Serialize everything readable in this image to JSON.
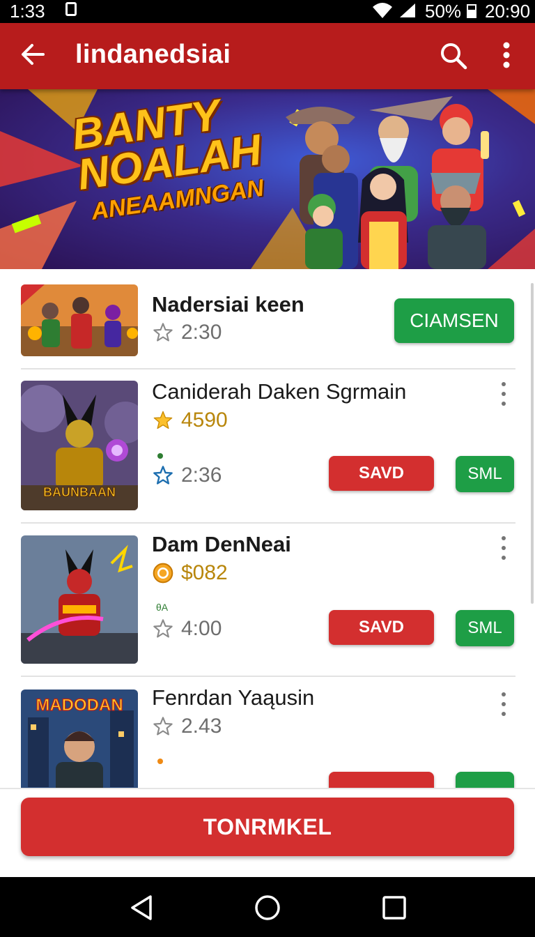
{
  "status_bar": {
    "time": "1:33",
    "battery": "50%",
    "clock": "20:90",
    "icons": [
      "notification-icon",
      "wifi-icon",
      "signal-icon",
      "battery-icon"
    ]
  },
  "app_bar": {
    "title": "lindanedsiai",
    "icons": [
      "back-arrow-icon",
      "search-icon",
      "more-vert-icon"
    ]
  },
  "banner": {
    "line1": "BANTY",
    "line2": "NOALAH",
    "line3": "ANEAAMNGAN"
  },
  "items": [
    {
      "name": "Nadersiai keen",
      "meta": "2:30",
      "meta_icon": "star-outline-icon",
      "primary_button": "CIAMSEN"
    },
    {
      "name": "Caniderah Daken Sgrmain",
      "price": "4590",
      "price_icon": "star-filled-icon",
      "meta": "2:36",
      "meta_icon": "star-outline-blue-icon",
      "thumb_caption": "BAUNBAAN",
      "save_button": "SAVD",
      "small_button": "SML"
    },
    {
      "name": "Dam DenNeai",
      "price": "$082",
      "price_icon": "coin-icon",
      "tag": "θA",
      "meta": "4:00",
      "meta_icon": "star-outline-icon",
      "save_button": "SAVD",
      "small_button": "SML"
    },
    {
      "name": "Fenrdan Yaąusin",
      "meta": "2.43",
      "meta_icon": "star-outline-icon",
      "thumb_caption": "MADODAN"
    }
  ],
  "cta": {
    "label": "TONRMKEL"
  },
  "colors": {
    "primary": "#b71c1c",
    "accent_red": "#d32f2f",
    "accent_green": "#1e9e46",
    "gold": "#b8860b"
  }
}
